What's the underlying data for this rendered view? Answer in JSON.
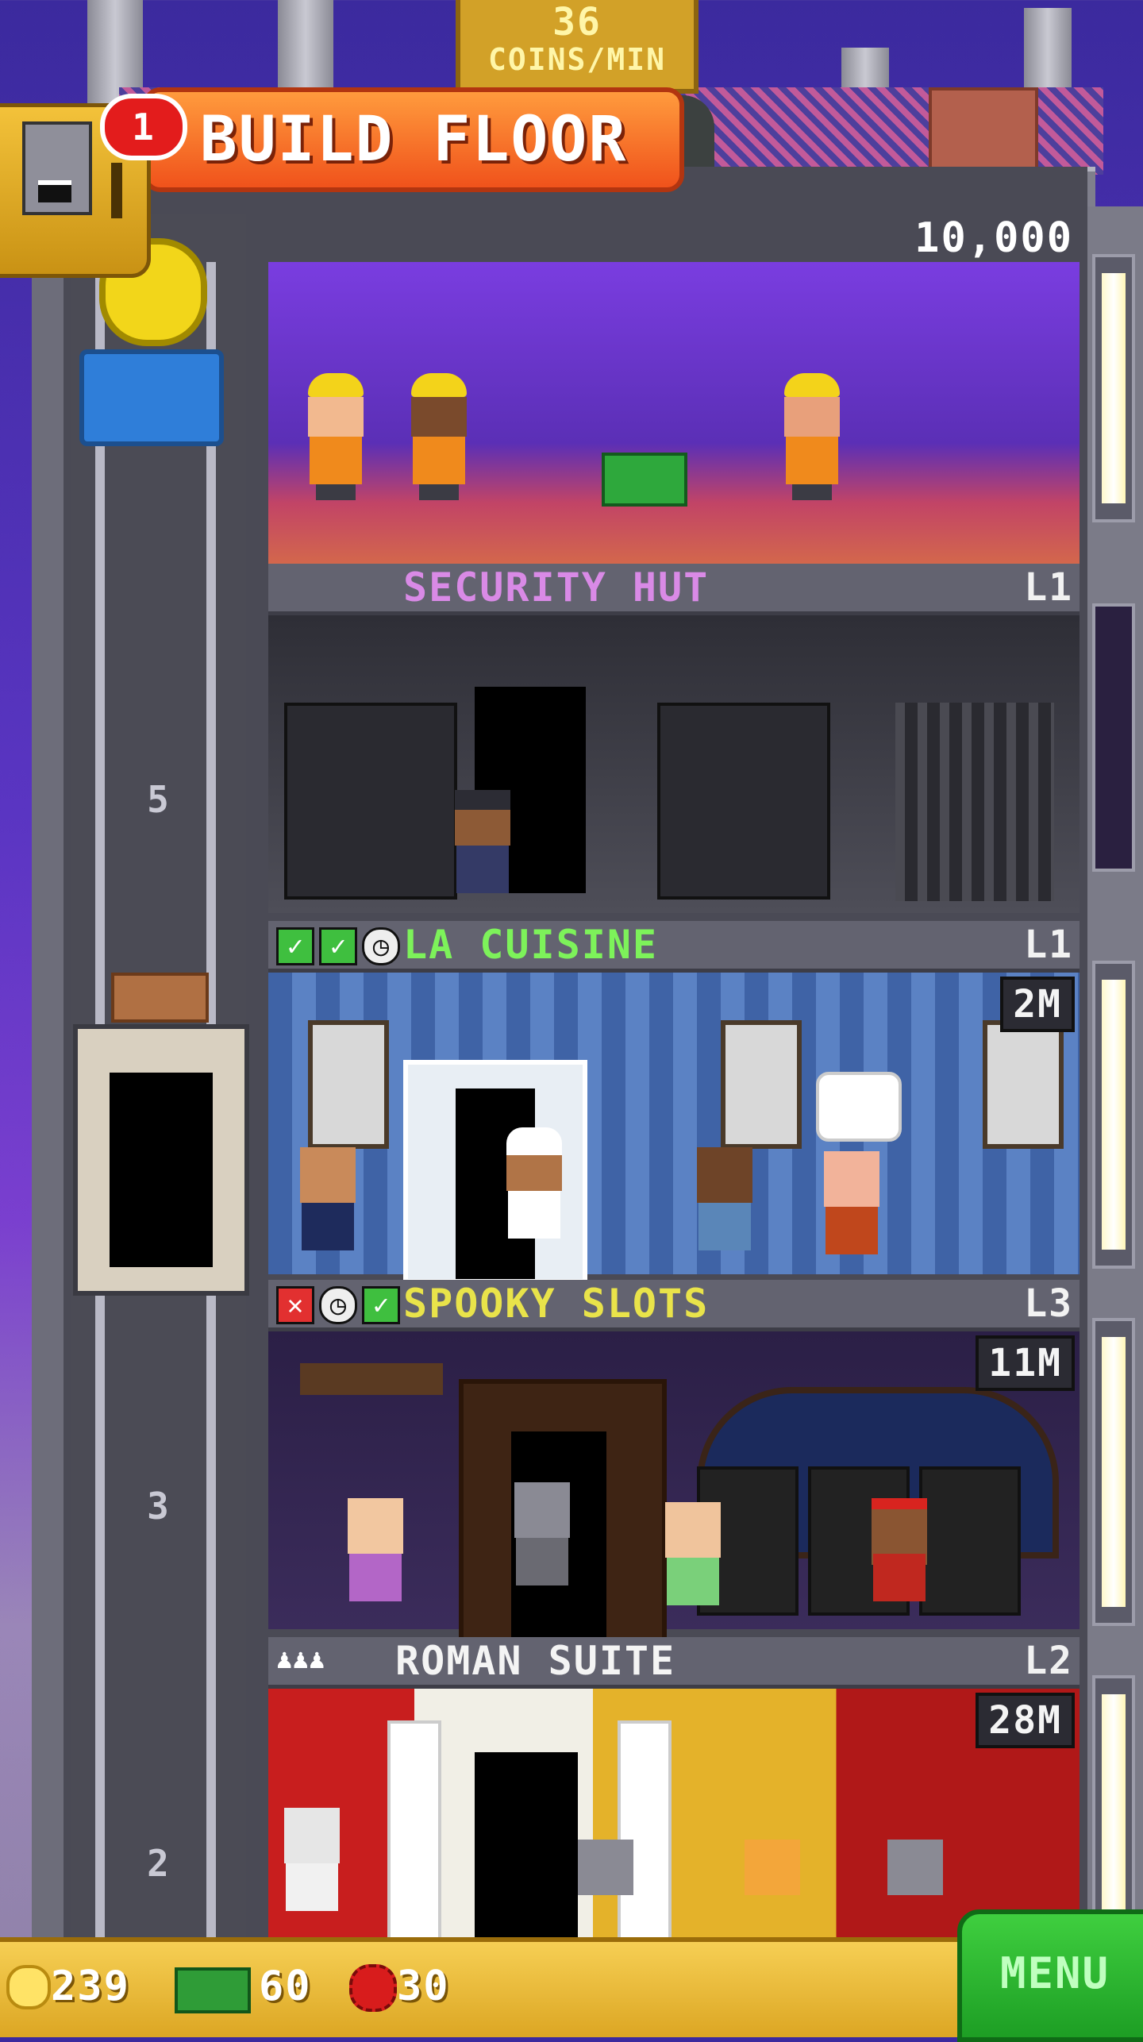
{
  "hud": {
    "coins_per_min_value": "36",
    "coins_per_min_label": "COINS/MIN",
    "notification_count": "1"
  },
  "build_floor": {
    "price": "10,000",
    "button_label": "BUILD FLOOR"
  },
  "shaft": {
    "numbers": [
      "5",
      "3",
      "2"
    ]
  },
  "floors": [
    {
      "name": "SECURITY HUT",
      "level": "L1",
      "value": "",
      "name_color": "#d98ae6",
      "status": []
    },
    {
      "name": "LA CUISINE",
      "level": "L1",
      "value": "2M",
      "name_color": "#7df25a",
      "status": [
        "check-icon",
        "check-icon",
        "clock-icon"
      ]
    },
    {
      "name": "SPOOKY SLOTS",
      "level": "L3",
      "value": "11M",
      "name_color": "#e9e34a",
      "status": [
        "x-icon",
        "clock-icon",
        "check-icon"
      ]
    },
    {
      "name": "ROMAN SUITE",
      "level": "L2",
      "value": "28M",
      "name_color": "#f4f4f4",
      "status": [
        "person-icon",
        "person-icon",
        "person-icon"
      ]
    }
  ],
  "bottom_bar": {
    "coins": "239",
    "bux": "60",
    "gems": "30",
    "menu_label": "MENU"
  },
  "colors": {
    "menu_green": "#1d9e24",
    "build_orange": "#f0521b",
    "hud_gold": "#d2a128"
  }
}
